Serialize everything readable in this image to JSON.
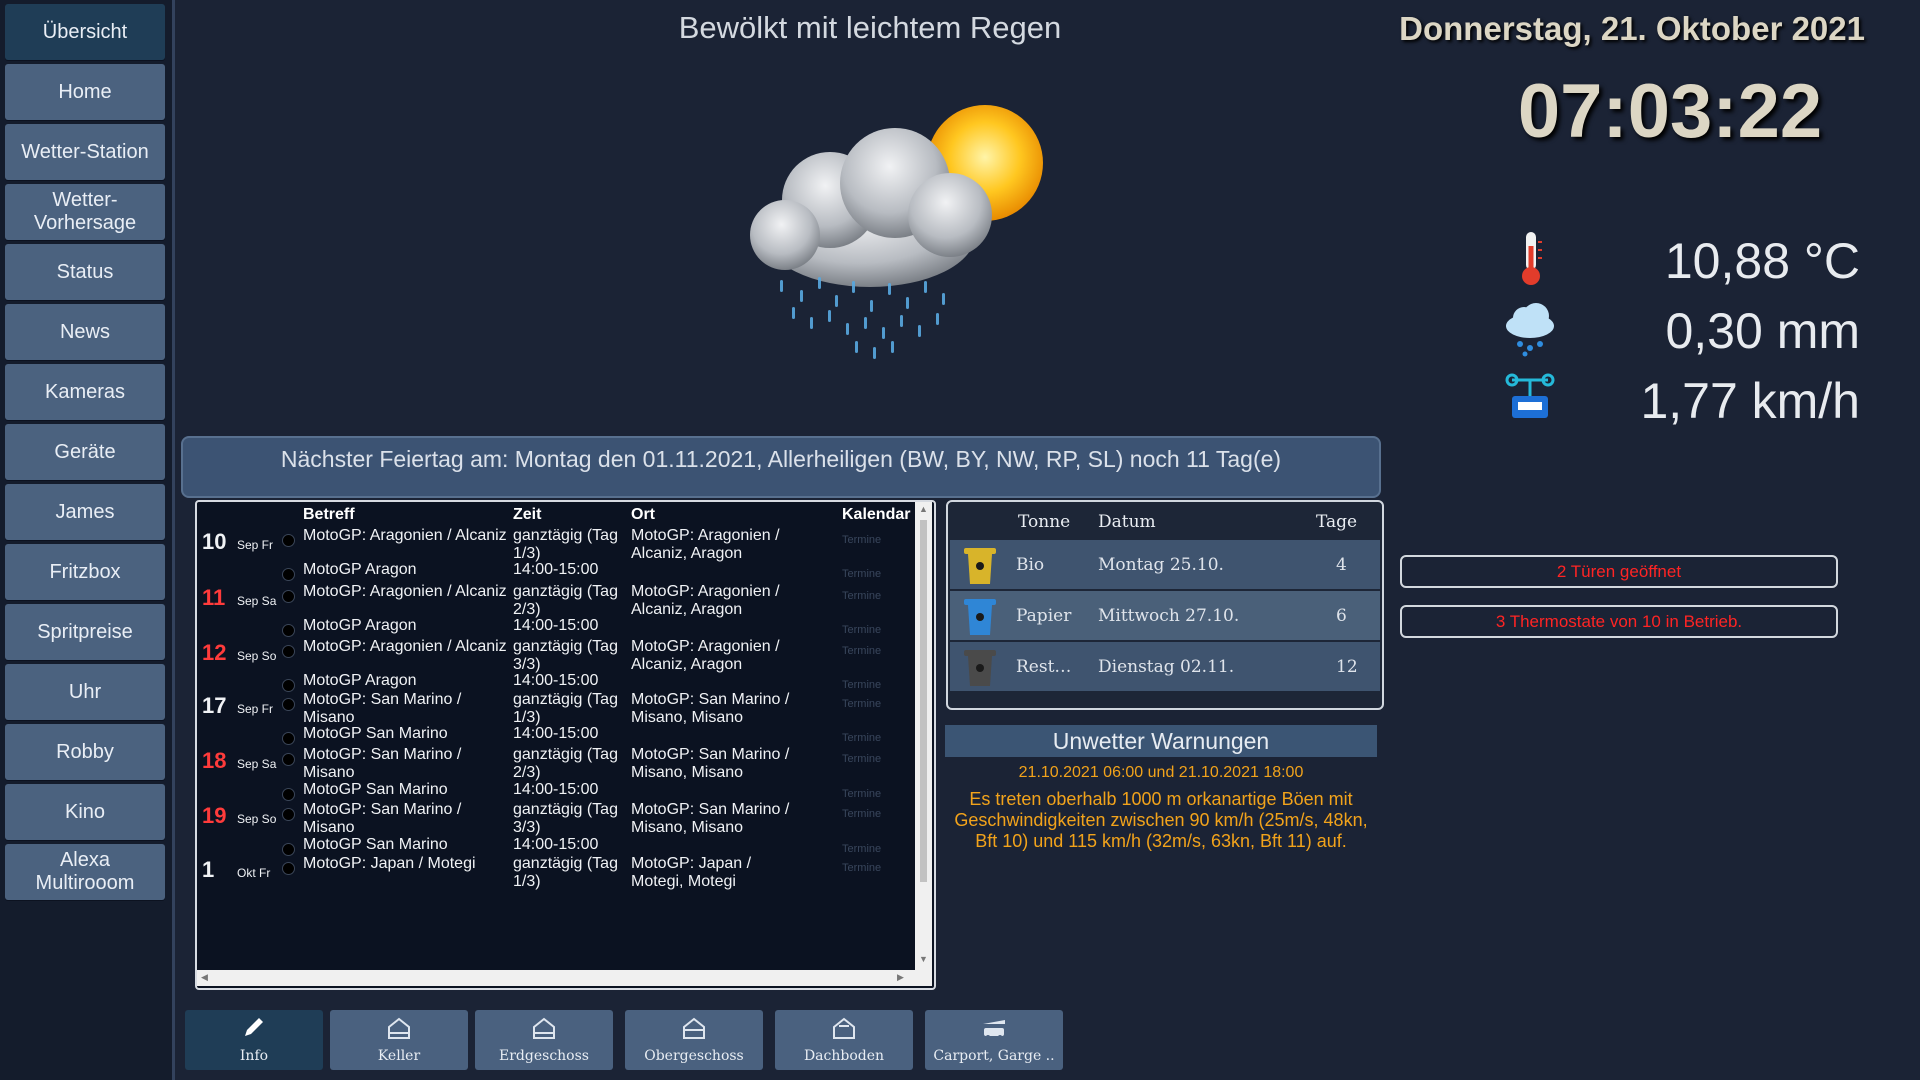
{
  "sidebar": {
    "items": [
      {
        "label": "Übersicht",
        "active": true
      },
      {
        "label": "Home"
      },
      {
        "label": "Wetter-Station"
      },
      {
        "label": "Wetter-\nVorhersage"
      },
      {
        "label": "Status"
      },
      {
        "label": "News"
      },
      {
        "label": "Kameras"
      },
      {
        "label": "Geräte"
      },
      {
        "label": "James"
      },
      {
        "label": "Fritzbox"
      },
      {
        "label": "Spritpreise"
      },
      {
        "label": "Uhr"
      },
      {
        "label": "Robby"
      },
      {
        "label": "Kino"
      },
      {
        "label": "Alexa\nMultirooom"
      }
    ]
  },
  "weather": {
    "description": "Bewölkt mit leichtem Regen",
    "icon": "cloud-sun-rain-icon"
  },
  "datetime": {
    "date": "Donnerstag, 21. Oktober 2021",
    "time": "07:03:22"
  },
  "metrics": {
    "temperature": "10,88 °C",
    "rain": "0,30 mm",
    "wind": "1,77 km/h"
  },
  "holiday": {
    "text": "Nächster Feiertag am: Montag den 01.11.2021, Allerheiligen (BW, BY, NW, RP, SL) noch 11 Tag(e)"
  },
  "calendar": {
    "headers": {
      "subject": "Betreff",
      "time": "Zeit",
      "place": "Ort",
      "calendar": "Kalendar"
    },
    "rows": [
      {
        "day": "10",
        "dow": "Sep Fr",
        "subject": "MotoGP: Aragonien / Alcaniz",
        "time": "ganztägig (Tag 1/3)",
        "place": "MotoGP: Aragonien / Alcaniz, Aragon",
        "cal": "Termine",
        "weekend": false
      },
      {
        "day": "",
        "dow": "",
        "subject": "MotoGP Aragon",
        "time": "14:00-15:00",
        "place": "",
        "cal": "Termine",
        "weekend": false
      },
      {
        "day": "11",
        "dow": "Sep Sa",
        "subject": "MotoGP: Aragonien / Alcaniz",
        "time": "ganztägig (Tag 2/3)",
        "place": "MotoGP: Aragonien / Alcaniz, Aragon",
        "cal": "Termine",
        "weekend": true
      },
      {
        "day": "",
        "dow": "",
        "subject": "MotoGP Aragon",
        "time": "14:00-15:00",
        "place": "",
        "cal": "Termine",
        "weekend": false
      },
      {
        "day": "12",
        "dow": "Sep So",
        "subject": "MotoGP: Aragonien / Alcaniz",
        "time": "ganztägig (Tag 3/3)",
        "place": "MotoGP: Aragonien / Alcaniz, Aragon",
        "cal": "Termine",
        "weekend": true
      },
      {
        "day": "",
        "dow": "",
        "subject": "MotoGP Aragon",
        "time": "14:00-15:00",
        "place": "",
        "cal": "Termine",
        "weekend": false
      },
      {
        "day": "17",
        "dow": "Sep Fr",
        "subject": "MotoGP: San Marino / Misano",
        "time": "ganztägig (Tag 1/3)",
        "place": "MotoGP: San Marino / Misano, Misano",
        "cal": "Termine",
        "weekend": false
      },
      {
        "day": "",
        "dow": "",
        "subject": "MotoGP San Marino",
        "time": "14:00-15:00",
        "place": "",
        "cal": "Termine",
        "weekend": false
      },
      {
        "day": "18",
        "dow": "Sep Sa",
        "subject": "MotoGP: San Marino / Misano",
        "time": "ganztägig (Tag 2/3)",
        "place": "MotoGP: San Marino / Misano, Misano",
        "cal": "Termine",
        "weekend": true
      },
      {
        "day": "",
        "dow": "",
        "subject": "MotoGP San Marino",
        "time": "14:00-15:00",
        "place": "",
        "cal": "Termine",
        "weekend": false
      },
      {
        "day": "19",
        "dow": "Sep So",
        "subject": "MotoGP: San Marino / Misano",
        "time": "ganztägig (Tag 3/3)",
        "place": "MotoGP: San Marino / Misano, Misano",
        "cal": "Termine",
        "weekend": true
      },
      {
        "day": "",
        "dow": "",
        "subject": "MotoGP San Marino",
        "time": "14:00-15:00",
        "place": "",
        "cal": "Termine",
        "weekend": false
      },
      {
        "day": "1",
        "dow": "Okt Fr",
        "subject": "MotoGP: Japan / Motegi",
        "time": "ganztägig (Tag 1/3)",
        "place": "MotoGP: Japan / Motegi, Motegi",
        "cal": "Termine",
        "weekend": false
      }
    ]
  },
  "trash": {
    "headers": {
      "bin": "Tonne",
      "date": "Datum",
      "days": "Tage"
    },
    "rows": [
      {
        "name": "Bio",
        "date": "Montag 25.10.",
        "days": "4",
        "color": "#d8b42a"
      },
      {
        "name": "Papier",
        "date": "Mittwoch 27.10.",
        "days": "6",
        "color": "#2f86d6"
      },
      {
        "name": "Rest…",
        "date": "Dienstag 02.11.",
        "days": "12",
        "color": "#4a4a4a"
      }
    ]
  },
  "warnings": {
    "title": "Unwetter Warnungen",
    "period": "21.10.2021 06:00 und 21.10.2021 18:00",
    "text": "Es treten oberhalb 1000 m orkanartige Böen mit Geschwindigkeiten zwischen 90 km/h (25m/s, 48kn, Bft 10) und 115 km/h (32m/s, 63kn, Bft 11) auf.",
    "color": "#f2a31b"
  },
  "alerts": {
    "doors": "2 Türen geöffnet",
    "thermostats": "3 Thermostate von 10 in Betrieb.",
    "color": "#ff2424"
  },
  "floors": {
    "items": [
      {
        "label": "Info",
        "icon": "pencil-icon",
        "active": true
      },
      {
        "label": "Keller",
        "icon": "house-icon"
      },
      {
        "label": "Erdgeschoss",
        "icon": "house-icon"
      },
      {
        "label": "Obergeschoss",
        "icon": "house-icon"
      },
      {
        "label": "Dachboden",
        "icon": "house-icon"
      },
      {
        "label": "Carport, Garge ..",
        "icon": "garage-icon"
      }
    ]
  }
}
